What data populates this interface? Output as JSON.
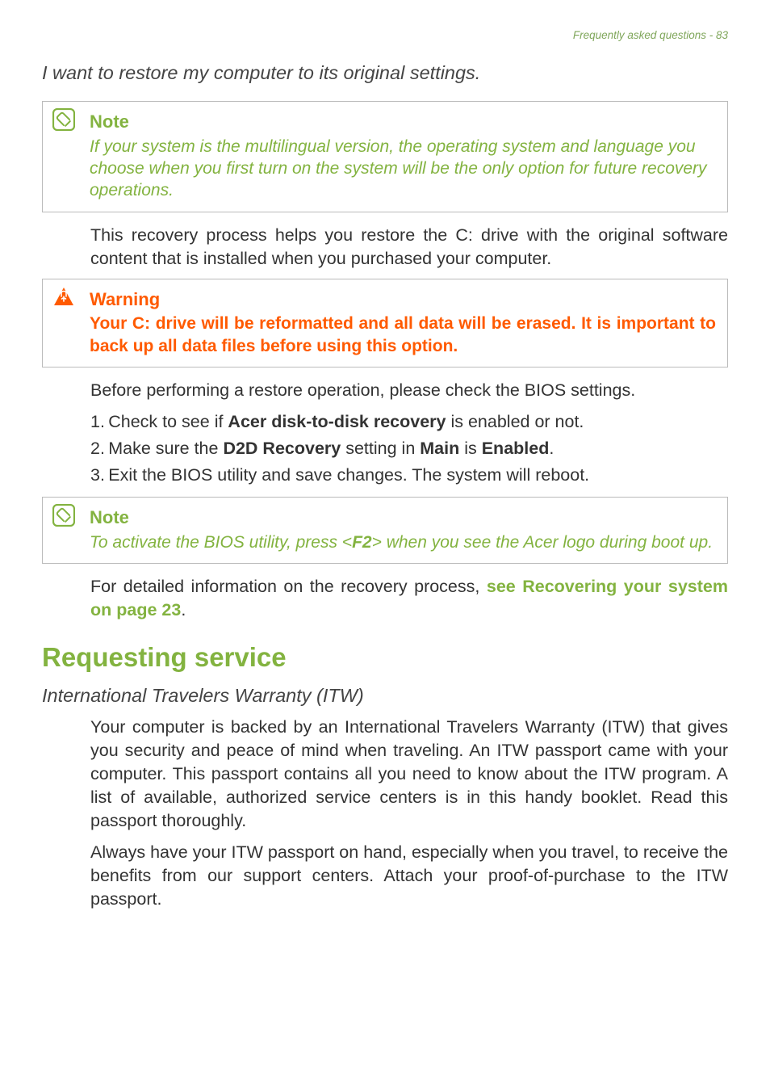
{
  "header": {
    "running": "Frequently asked questions - 83"
  },
  "q1": {
    "heading": "I want to restore my computer to its original settings."
  },
  "note1": {
    "title": "Note",
    "text": "If your system is the multilingual version, the operating system and language you choose when you first turn on the system will be the only option for future recovery operations."
  },
  "body1": "This recovery process helps you restore the C: drive with the original software content that is installed when you purchased your computer.",
  "warning1": {
    "title": "Warning",
    "text": "Your C: drive will be reformatted and all data will be erased. It is important to back up all data files before using this option."
  },
  "body2": "Before performing a restore operation, please check the BIOS settings.",
  "list": {
    "item1_pre": "1. Check to see if ",
    "item1_bold": "Acer disk-to-disk recovery",
    "item1_post": " is enabled or not.",
    "item2_pre": "2. Make sure the ",
    "item2_b1": "D2D Recovery",
    "item2_mid1": " setting in ",
    "item2_b2": "Main",
    "item2_mid2": " is ",
    "item2_b3": "Enabled",
    "item2_post": ".",
    "item3": "3. Exit the BIOS utility and save changes. The system will reboot."
  },
  "note2": {
    "title": "Note",
    "pre": "To activate the BIOS utility, press <",
    "key": "F2",
    "post": "> when you see the Acer logo during boot up."
  },
  "body3_pre": "For detailed information on the recovery process, ",
  "body3_link": "see Recovering your system on page 23",
  "body3_post": ".",
  "section2": {
    "heading": "Requesting service",
    "sub": "International Travelers Warranty (ITW)",
    "p1": "Your computer is backed by an International Travelers Warranty (ITW) that gives you security and peace of mind when traveling. An ITW passport came with your computer. This passport contains all you need to know about the ITW program. A list of available, authorized service centers is in this handy booklet. Read this passport thoroughly.",
    "p2": "Always have your ITW passport on hand, especially when you travel, to receive the benefits from our support centers. Attach your proof-of-purchase to the ITW passport."
  }
}
